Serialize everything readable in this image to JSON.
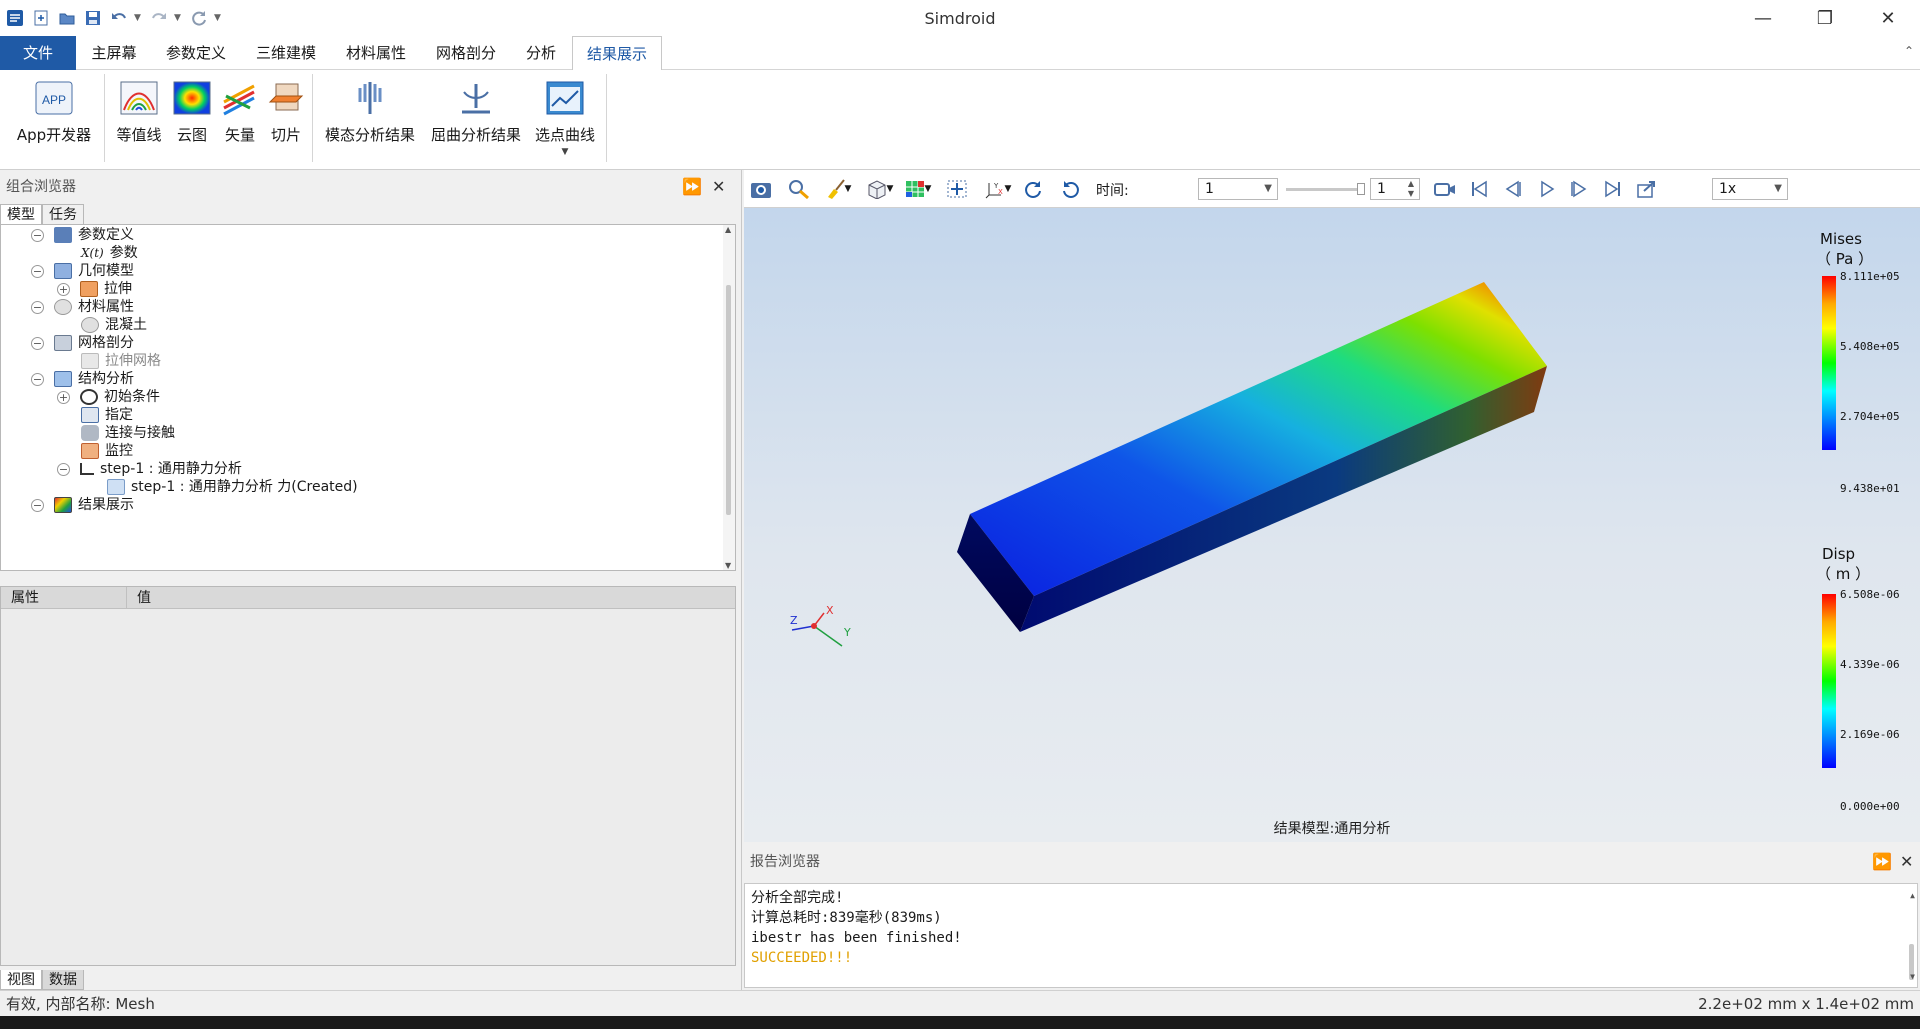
{
  "window": {
    "title": "Simdroid"
  },
  "menu": {
    "tabs": [
      "文件",
      "主屏幕",
      "参数定义",
      "三维建模",
      "材料属性",
      "网格剖分",
      "分析",
      "结果展示"
    ]
  },
  "ribbon": {
    "buttons": [
      "App开发器",
      "等值线",
      "云图",
      "矢量",
      "切片",
      "模态分析结果",
      "屈曲分析结果",
      "选点曲线"
    ]
  },
  "left": {
    "title": "组合浏览器",
    "tabs": [
      "模型",
      "任务"
    ],
    "tree": [
      {
        "label": "参数定义"
      },
      {
        "label": "参数",
        "prefix": "X(t)"
      },
      {
        "label": "几何模型"
      },
      {
        "label": "拉伸"
      },
      {
        "label": "材料属性"
      },
      {
        "label": "混凝土"
      },
      {
        "label": "网格剖分"
      },
      {
        "label": "拉伸网格"
      },
      {
        "label": "结构分析"
      },
      {
        "label": "初始条件"
      },
      {
        "label": "指定"
      },
      {
        "label": "连接与接触"
      },
      {
        "label": "监控"
      },
      {
        "label": "step-1 : 通用静力分析"
      },
      {
        "label": "step-1 : 通用静力分析 力(Created)"
      },
      {
        "label": "结果展示"
      }
    ],
    "props": {
      "col1": "属性",
      "col2": "值"
    },
    "bottom_tabs": [
      "视图",
      "数据"
    ]
  },
  "viewer": {
    "time_label": "时间:",
    "time_value": "1",
    "spin_value": "1",
    "speed": "1x",
    "caption": "结果模型:通用分析",
    "legend1": {
      "title": "Mises",
      "unit": "（ Pa ）",
      "ticks": [
        "8.111e+05",
        "5.408e+05",
        "2.704e+05",
        "9.438e+01"
      ]
    },
    "legend2": {
      "title": "Disp",
      "unit": "（ m ）",
      "ticks": [
        "6.508e-06",
        "4.339e-06",
        "2.169e-06",
        "0.000e+00"
      ]
    },
    "axes": {
      "x": "X",
      "y": "Y",
      "z": "Z"
    }
  },
  "report": {
    "title": "报告浏览器",
    "lines": [
      "分析全部完成!",
      "计算总耗时:839毫秒(839ms)",
      "ibestr has been finished!",
      "SUCCEEDED!!!"
    ]
  },
  "status": {
    "left": "有效, 内部名称: Mesh",
    "right": "2.2e+02 mm x 1.4e+02 mm"
  },
  "colors": {
    "accent": "#1f5aa6",
    "success": "#e0a000"
  }
}
